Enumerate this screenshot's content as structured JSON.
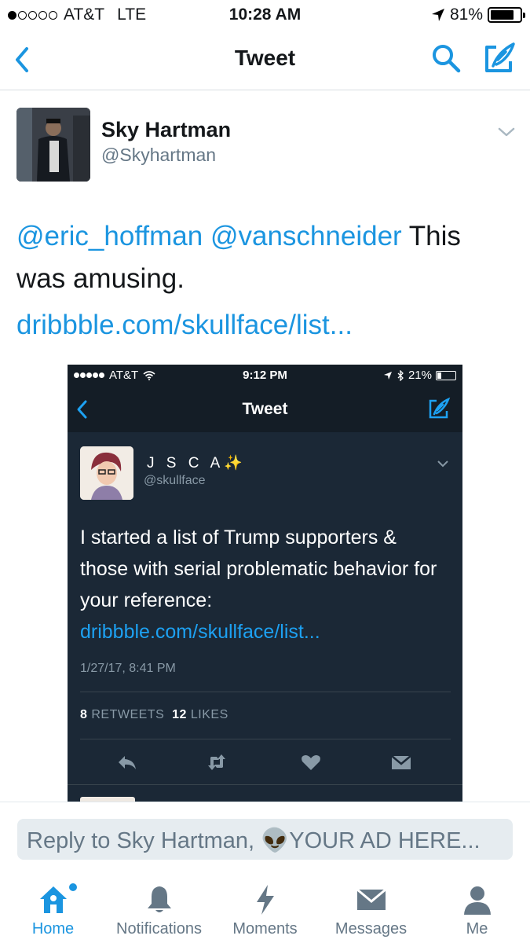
{
  "status_bar": {
    "carrier": "AT&T",
    "network": "LTE",
    "time": "10:28 AM",
    "battery": "81%",
    "battery_level": 0.81,
    "signal_bars": 1
  },
  "nav": {
    "title": "Tweet",
    "back_icon": "chevron-left-icon",
    "search_icon": "search-icon",
    "compose_icon": "compose-icon"
  },
  "tweet": {
    "author_name": "Sky Hartman",
    "author_handle": "@Skyhartman",
    "mention_1": "@eric_hoffman",
    "mention_2": "@vanschneider",
    "text": " This was amusing.",
    "link": "dribbble.com/skullface/list..."
  },
  "embedded_screenshot": {
    "status": {
      "carrier": "AT&T",
      "time": "9:12 PM",
      "battery": "21%"
    },
    "nav_title": "Tweet",
    "author_name": "J S C A✨",
    "author_handle": "@skullface",
    "text": "I started a list of Trump supporters & those with serial problematic behavior for your reference: ",
    "link": "dribbble.com/skullface/list...",
    "date": "1/27/17, 8:41 PM",
    "retweets_count": "8",
    "retweets_label": "RETWEETS",
    "likes_count": "12",
    "likes_label": "LIKES"
  },
  "reply": {
    "placeholder": "Reply to Sky Hartman, 👽YOUR AD HERE..."
  },
  "tabbar": {
    "tabs": [
      {
        "label": "Home",
        "icon": "home-icon",
        "active": true
      },
      {
        "label": "Notifications",
        "icon": "bell-icon",
        "active": false
      },
      {
        "label": "Moments",
        "icon": "lightning-icon",
        "active": false
      },
      {
        "label": "Messages",
        "icon": "envelope-icon",
        "active": false
      },
      {
        "label": "Me",
        "icon": "person-icon",
        "active": false
      }
    ]
  },
  "colors": {
    "accent": "#1b95e0",
    "secondary_text": "#657786",
    "embedded_bg": "#1b2836"
  }
}
